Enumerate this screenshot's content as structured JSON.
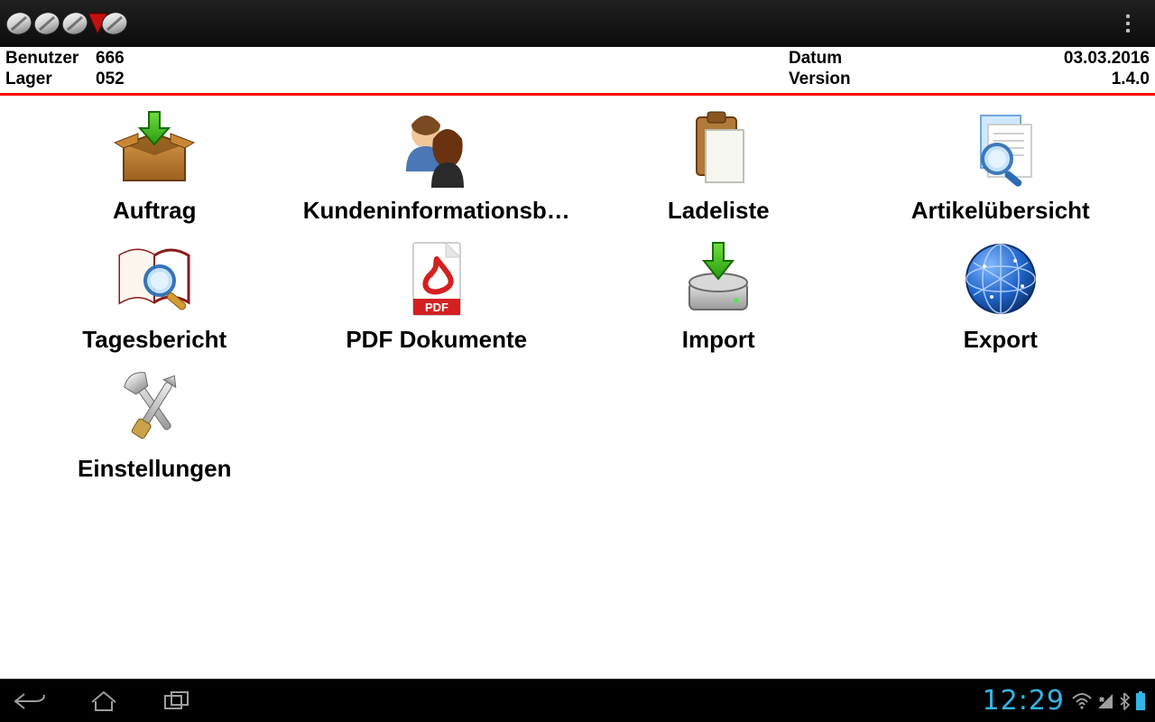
{
  "appbar": {
    "logo_alt": "COSYS",
    "overflow_label": "Menü"
  },
  "info": {
    "user_label": "Benutzer",
    "user_value": "666",
    "store_label": "Lager",
    "store_value": "052",
    "date_label": "Datum",
    "date_value": "03.03.2016",
    "version_label": "Version",
    "version_value": "1.4.0"
  },
  "tiles": {
    "auftrag": "Auftrag",
    "kundeninfo": "Kundeninformationsb…",
    "ladeliste": "Ladeliste",
    "artikeluebersicht": "Artikelübersicht",
    "tagesbericht": "Tagesbericht",
    "pdf": "PDF Dokumente",
    "import": "Import",
    "export": "Export",
    "einstellungen": "Einstellungen"
  },
  "navbar": {
    "clock": "12:29"
  }
}
